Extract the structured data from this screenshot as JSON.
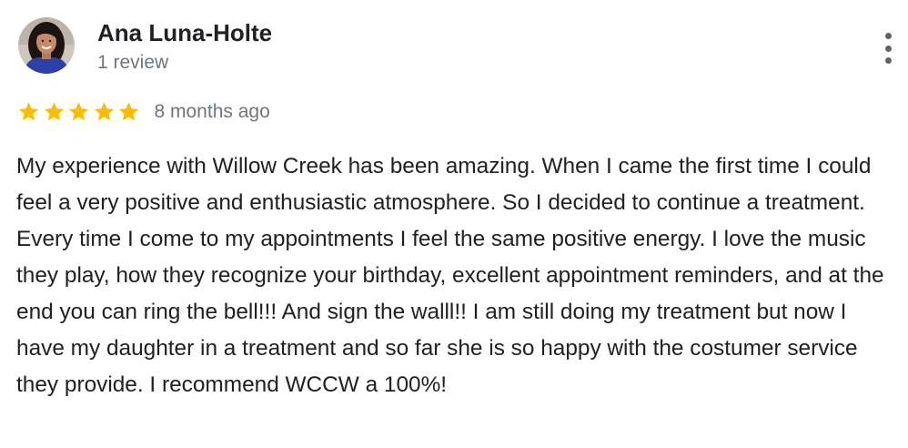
{
  "reviewer": {
    "name": "Ana Luna-Holte",
    "review_count": "1 review",
    "avatar_icon": "user-avatar-photo"
  },
  "menu": {
    "icon": "more-vertical-icon"
  },
  "rating": {
    "stars": 5,
    "max_stars": 5,
    "star_color": "#fbbc04",
    "time": "8 months ago"
  },
  "review": {
    "text": "My experience with Willow Creek has been amazing. When I came the first time I could feel a very positive and enthusiastic atmosphere. So I decided to continue a treatment. Every time I come to my appointments I feel the same positive energy. I love the music they play, how they recognize your birthday, excellent appointment reminders, and at the end you can ring the bell!!! And sign the walll!! I am still doing my treatment but now I have my daughter in a treatment and so far she is so happy with the costumer service they provide. I recommend WCCW a 100%!"
  }
}
